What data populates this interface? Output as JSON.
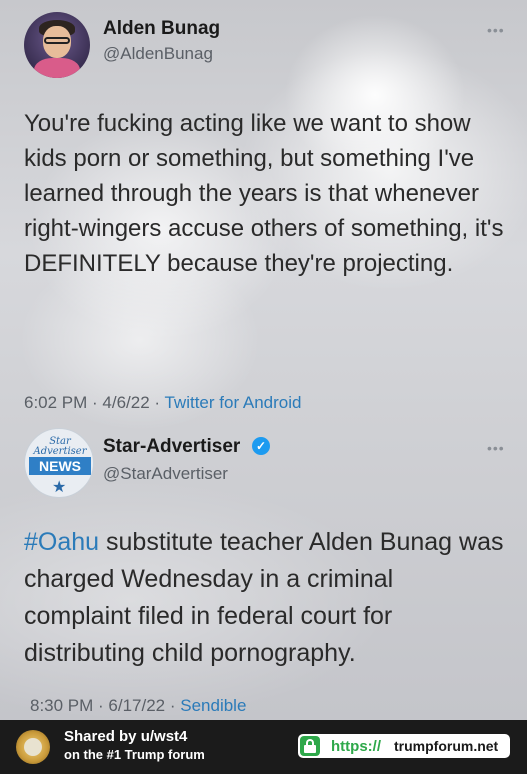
{
  "tweet1": {
    "name": "Alden Bunag",
    "handle": "@AldenBunag",
    "more": "•••",
    "text": "You're fucking acting like we want to show kids porn or something, but something I've learned through the years is that whenever right-wingers accuse others of something, it's DEFINITELY because they're projecting.",
    "time_date": "6:02 PM · 4/6/22 · ",
    "source": "Twitter for Android"
  },
  "tweet2": {
    "name": "Star-Advertiser",
    "handle": "@StarAdvertiser",
    "more": "•••",
    "avatar_top": "Star\nAdvertiser",
    "avatar_news": "NEWS",
    "hashtag": "#Oahu",
    "text": " substitute teacher Alden Bunag was charged Wednesday in a criminal complaint filed in federal court for distributing child pornography.",
    "time_date": "8:30 PM · 6/17/22 · ",
    "source": "Sendible"
  },
  "banner": {
    "line1": "Shared by u/wst4",
    "line2": "on the #1 Trump forum",
    "url_scheme": "https://",
    "url_host": "trumpforum.net"
  },
  "icons": {
    "verified": "verified-badge-icon",
    "lock": "lock-icon",
    "more": "more-options-icon"
  },
  "colors": {
    "link": "#2b7bb9",
    "verified": "#1d9bf0",
    "lock_green": "#2ea84a",
    "banner_bg": "#1b1b1b"
  }
}
